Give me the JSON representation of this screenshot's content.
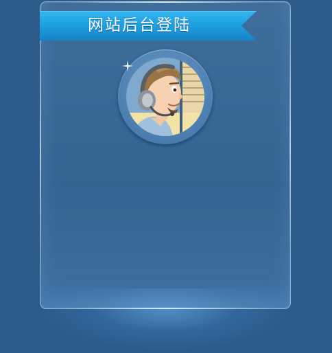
{
  "panel": {
    "title": "网站后台登陆"
  },
  "avatar": {
    "icon": "support-agent-avatar"
  },
  "colors": {
    "background": "#2c5b8a",
    "ribbon": "#1e9ee0"
  }
}
